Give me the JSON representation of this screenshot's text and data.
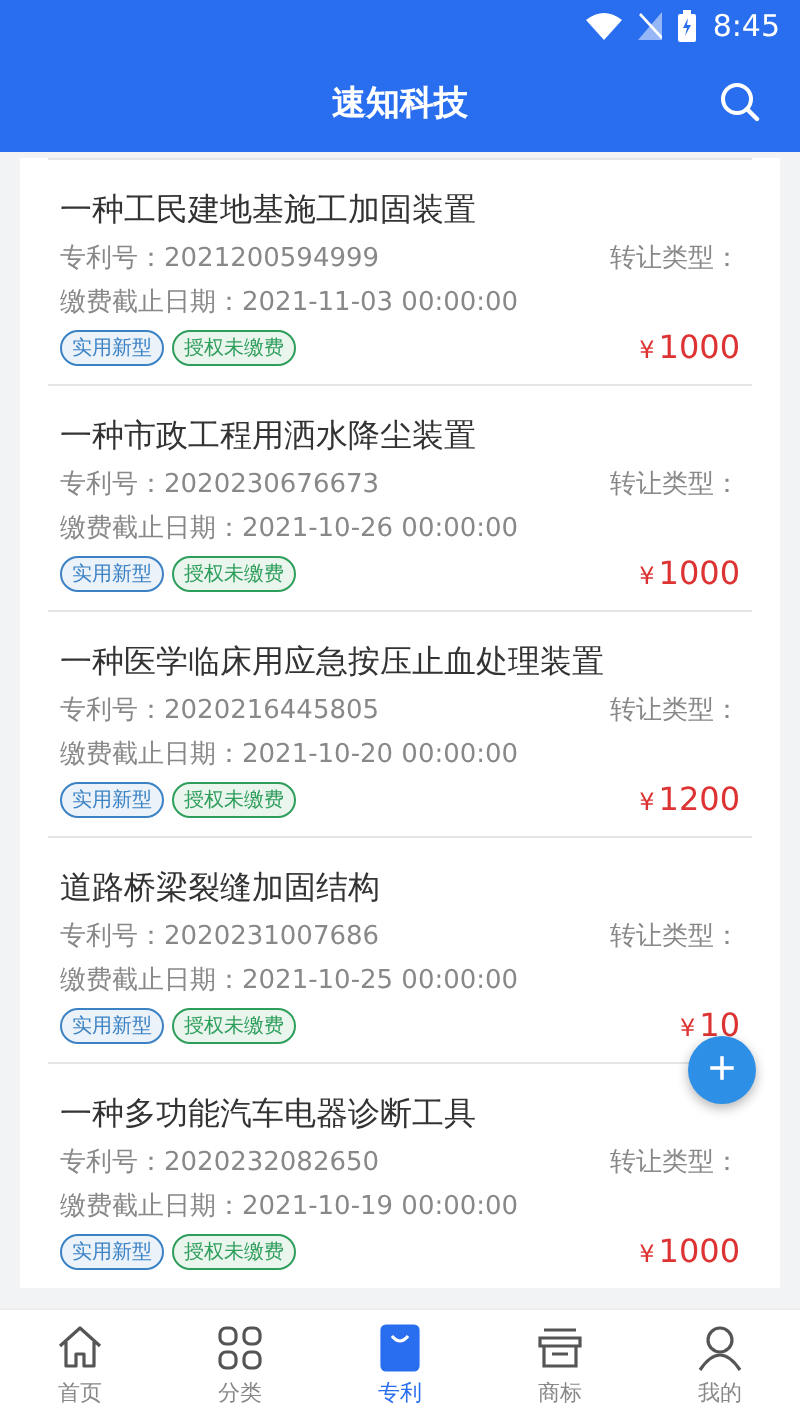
{
  "status_bar": {
    "time": "8:45"
  },
  "header": {
    "title": "速知科技"
  },
  "patents": [
    {
      "title": "一种工民建地基施工加固装置",
      "number_label": "专利号：",
      "number": "2021200594999",
      "transfer_label": "转让类型：",
      "deadline_label": "缴费截止日期：",
      "deadline": "2021-11-03 00:00:00",
      "tags": [
        {
          "text": "实用新型",
          "color": "#3b82c4"
        },
        {
          "text": "授权未缴费",
          "color": "#2e9e5b"
        }
      ],
      "currency": "¥",
      "amount": "1000"
    },
    {
      "title": "一种市政工程用洒水降尘装置",
      "number_label": "专利号：",
      "number": "2020230676673",
      "transfer_label": "转让类型：",
      "deadline_label": "缴费截止日期：",
      "deadline": "2021-10-26 00:00:00",
      "tags": [
        {
          "text": "实用新型",
          "color": "#3b82c4"
        },
        {
          "text": "授权未缴费",
          "color": "#2e9e5b"
        }
      ],
      "currency": "¥",
      "amount": "1000"
    },
    {
      "title": "一种医学临床用应急按压止血处理装置",
      "number_label": "专利号：",
      "number": "2020216445805",
      "transfer_label": "转让类型：",
      "deadline_label": "缴费截止日期：",
      "deadline": "2021-10-20 00:00:00",
      "tags": [
        {
          "text": "实用新型",
          "color": "#3b82c4"
        },
        {
          "text": "授权未缴费",
          "color": "#2e9e5b"
        }
      ],
      "currency": "¥",
      "amount": "1200"
    },
    {
      "title": "道路桥梁裂缝加固结构",
      "number_label": "专利号：",
      "number": "2020231007686",
      "transfer_label": "转让类型：",
      "deadline_label": "缴费截止日期：",
      "deadline": "2021-10-25 00:00:00",
      "tags": [
        {
          "text": "实用新型",
          "color": "#3b82c4"
        },
        {
          "text": "授权未缴费",
          "color": "#2e9e5b"
        }
      ],
      "currency": "¥",
      "amount": "10"
    },
    {
      "title": "一种多功能汽车电器诊断工具",
      "number_label": "专利号：",
      "number": "2020232082650",
      "transfer_label": "转让类型：",
      "deadline_label": "缴费截止日期：",
      "deadline": "2021-10-19 00:00:00",
      "tags": [
        {
          "text": "实用新型",
          "color": "#3b82c4"
        },
        {
          "text": "授权未缴费",
          "color": "#2e9e5b"
        }
      ],
      "currency": "¥",
      "amount": "1000"
    }
  ],
  "fab": {
    "label": "+"
  },
  "tabs": [
    {
      "kind": "home",
      "label": "首页",
      "selected": false
    },
    {
      "kind": "category",
      "label": "分类",
      "selected": false
    },
    {
      "kind": "patent",
      "label": "专利",
      "selected": true
    },
    {
      "kind": "trademark",
      "label": "商标",
      "selected": false
    },
    {
      "kind": "profile",
      "label": "我的",
      "selected": false
    }
  ]
}
